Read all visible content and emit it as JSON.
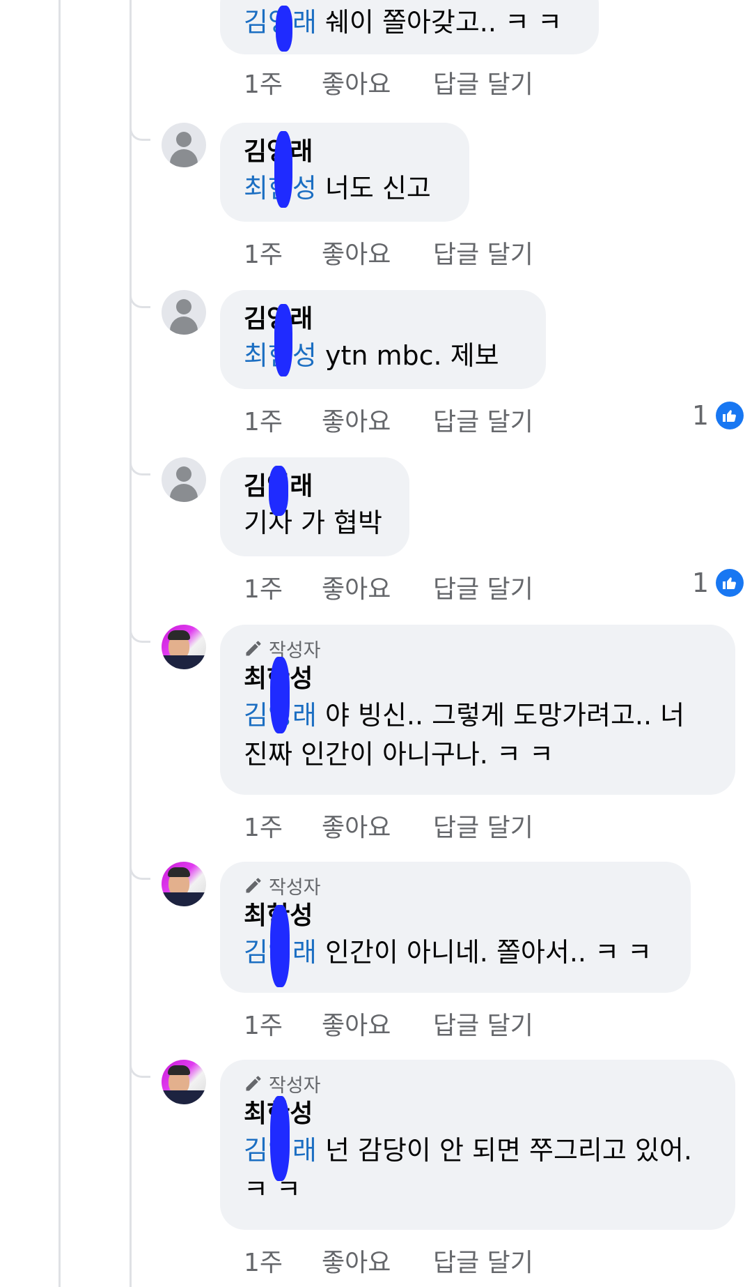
{
  "actions": {
    "time": "1주",
    "like": "좋아요",
    "reply": "답글 달기"
  },
  "author_badge": "작성자",
  "comments": [
    {
      "mention": "김영래",
      "text": " 쉐이 쫄아갖고.. ㅋ ㅋ"
    },
    {
      "name": "김영래",
      "mention": "최한성",
      "text": " 너도 신고"
    },
    {
      "name": "김영래",
      "mention": "최한성",
      "text": " ytn  mbc. 제보",
      "reaction_count": "1"
    },
    {
      "name": "김영래",
      "text": "기자 가 협박",
      "reaction_count": "1"
    },
    {
      "name": "최한성",
      "mention": "김영래",
      "text": " 야 빙신.. 그렇게 도망가려고.. 너 진짜 인간이 아니구나. ㅋ ㅋ"
    },
    {
      "name": "최한성",
      "mention": "김영래",
      "text": " 인간이 아니네. 쫄아서.. ㅋ ㅋ"
    },
    {
      "name": "최한성",
      "mention": "김영래",
      "text": " 넌 감당이 안 되면 쭈그리고 있어. ㅋ ㅋ"
    }
  ]
}
